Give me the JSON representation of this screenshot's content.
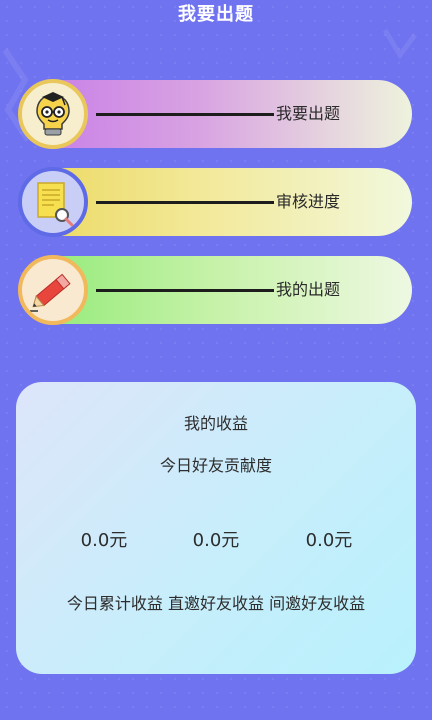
{
  "header": {
    "title": "我要出题"
  },
  "menu": [
    {
      "label": "我要出题",
      "icon": "professor-lightbulb-icon"
    },
    {
      "label": "审核进度",
      "icon": "document-magnifier-icon"
    },
    {
      "label": "我的出题",
      "icon": "pencil-icon"
    }
  ],
  "earnings": {
    "title": "我的收益",
    "subtitle": "今日好友贡献度",
    "values": [
      "0.0元",
      "0.0元",
      "0.0元"
    ],
    "labels": "今日累计收益 直邀好友收益 间邀好友收益"
  },
  "colors": {
    "background": "#6F73F0",
    "pill1_start": "#C77BE8",
    "pill2_start": "#EBD85E",
    "pill3_start": "#8EEA74",
    "card": "#C9EDFB"
  }
}
